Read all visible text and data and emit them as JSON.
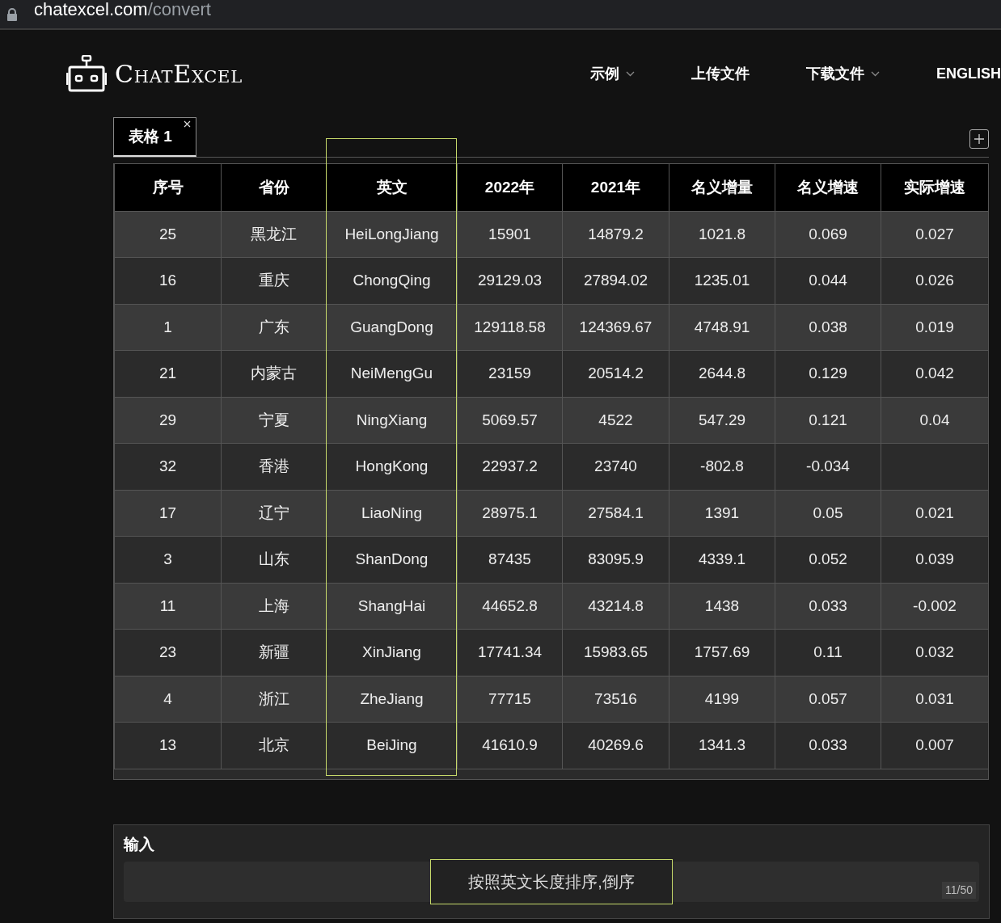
{
  "address_bar": {
    "domain": "chatexcel.com",
    "path": "/convert"
  },
  "header": {
    "logo": "ChatExcel",
    "nav": [
      {
        "label": "示例",
        "dropdown": true
      },
      {
        "label": "上传文件",
        "dropdown": false
      },
      {
        "label": "下载文件",
        "dropdown": true
      },
      {
        "label": "ENGLISH",
        "dropdown": false
      }
    ]
  },
  "sheet_tabs": [
    {
      "label": "表格 1",
      "selected": true
    }
  ],
  "table": {
    "columns": [
      {
        "label": "序号",
        "highlighted": false
      },
      {
        "label": "省份",
        "highlighted": false
      },
      {
        "label": "英文",
        "highlighted": true
      },
      {
        "label": "2022年",
        "highlighted": false
      },
      {
        "label": "2021年",
        "highlighted": false
      },
      {
        "label": "名义增量",
        "highlighted": false
      },
      {
        "label": "名义增速",
        "highlighted": false
      },
      {
        "label": "实际增速",
        "highlighted": false
      }
    ],
    "rows": [
      [
        "25",
        "黑龙江",
        "HeiLongJiang",
        "15901",
        "14879.2",
        "1021.8",
        "0.069",
        "0.027"
      ],
      [
        "16",
        "重庆",
        "ChongQing",
        "29129.03",
        "27894.02",
        "1235.01",
        "0.044",
        "0.026"
      ],
      [
        "1",
        "广东",
        "GuangDong",
        "129118.58",
        "124369.67",
        "4748.91",
        "0.038",
        "0.019"
      ],
      [
        "21",
        "内蒙古",
        "NeiMengGu",
        "23159",
        "20514.2",
        "2644.8",
        "0.129",
        "0.042"
      ],
      [
        "29",
        "宁夏",
        "NingXiang",
        "5069.57",
        "4522",
        "547.29",
        "0.121",
        "0.04"
      ],
      [
        "32",
        "香港",
        "HongKong",
        "22937.2",
        "23740",
        "-802.8",
        "-0.034",
        null
      ],
      [
        "17",
        "辽宁",
        "LiaoNing",
        "28975.1",
        "27584.1",
        "1391",
        "0.05",
        "0.021"
      ],
      [
        "3",
        "山东",
        "ShanDong",
        "87435",
        "83095.9",
        "4339.1",
        "0.052",
        "0.039"
      ],
      [
        "11",
        "上海",
        "ShangHai",
        "44652.8",
        "43214.8",
        "1438",
        "0.033",
        "-0.002"
      ],
      [
        "23",
        "新疆",
        "XinJiang",
        "17741.34",
        "15983.65",
        "1757.69",
        "0.11",
        "0.032"
      ],
      [
        "4",
        "浙江",
        "ZheJiang",
        "77715",
        "73516",
        "4199",
        "0.057",
        "0.031"
      ],
      [
        "13",
        "北京",
        "BeiJing",
        "41610.9",
        "40269.6",
        "1341.3",
        "0.033",
        "0.007"
      ]
    ]
  },
  "input": {
    "label": "输入",
    "value": "按照英文长度排序,倒序",
    "counter": "11/50",
    "highlighted": true
  }
}
